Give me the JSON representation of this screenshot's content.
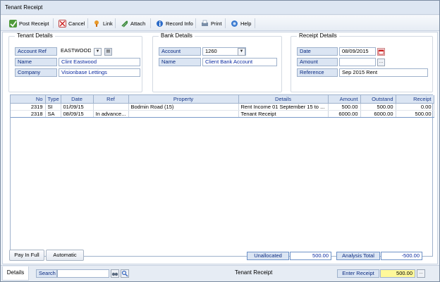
{
  "window": {
    "title": "Tenant Receipt"
  },
  "toolbar": {
    "post_receipt": "Post Receipt",
    "cancel": "Cancel",
    "link": "Link",
    "attach": "Attach",
    "record_info": "Record Info",
    "print": "Print",
    "help": "Help"
  },
  "tenant": {
    "legend": "Tenant Details",
    "account_ref_label": "Account Ref",
    "account_ref_value": "EASTWOOD",
    "name_label": "Name",
    "name_value": "Clint Eastwood",
    "company_label": "Company",
    "company_value": "Visionbase Lettings"
  },
  "bank": {
    "legend": "Bank Details",
    "account_label": "Account",
    "account_value": "1260",
    "name_label": "Name",
    "name_value": "Client Bank Account"
  },
  "receipt": {
    "legend": "Receipt Details",
    "date_label": "Date",
    "date_value": "08/09/2015",
    "amount_label": "Amount",
    "amount_value": "",
    "reference_label": "Reference",
    "reference_value": "Sep 2015 Rent"
  },
  "grid": {
    "columns": [
      "No",
      "Type",
      "Date",
      "Ref",
      "Property",
      "Details",
      "Amount",
      "Outstand",
      "Receipt"
    ],
    "rows": [
      {
        "no": "2319",
        "type": "SI",
        "date": "01/09/15",
        "ref": "",
        "property": "Bodmin Road (15)",
        "details": "Rent Income 01 September 15 to ...",
        "amount": "500.00",
        "outstand": "500.00",
        "receipt": "0.00"
      },
      {
        "no": "2318",
        "type": "SA",
        "date": "08/09/15",
        "ref": "In advance...",
        "property": "",
        "details": "Tenant Receipt",
        "amount": "6000.00",
        "outstand": "6000.00",
        "receipt": "500.00"
      }
    ]
  },
  "footer": {
    "pay_in_full": "Pay In Full",
    "automatic": "Automatic",
    "unallocated_label": "Unallocated",
    "unallocated_value": "500.00",
    "analysis_total_label": "Analysis Total",
    "analysis_total_value": "-500.00"
  },
  "statusbar": {
    "details_tab": "Details",
    "search_label": "Search",
    "search_value": "",
    "center_text": "Tenant Receipt",
    "enter_receipt_label": "Enter Receipt",
    "enter_receipt_value": "500.00"
  },
  "icons": {
    "post_receipt": "post-receipt-icon",
    "cancel": "cancel-icon",
    "link": "link-icon",
    "attach": "attach-icon",
    "record_info": "record-info-icon",
    "print": "print-icon",
    "help": "help-icon"
  },
  "colors": {
    "label_bg": "#dbe5f3",
    "label_text": "#0a2a80",
    "value_text": "#0a2aa0",
    "highlight_yellow": "#fff89a"
  }
}
